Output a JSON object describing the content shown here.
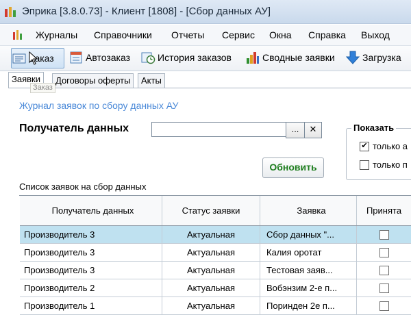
{
  "window": {
    "title": "Эприка [3.8.0.73] - Клиент [1808] - [Сбор данных АУ]"
  },
  "menu": [
    "Журналы",
    "Справочники",
    "Отчеты",
    "Сервис",
    "Окна",
    "Справка",
    "Выход"
  ],
  "toolbar": {
    "order": "Заказ",
    "auto_order": "Автозаказ",
    "order_history": "История заказов",
    "summary_requests": "Сводные заявки",
    "load": "Загрузка"
  },
  "tabs": [
    "Заявки",
    "Договоры оферты",
    "Акты"
  ],
  "tooltip": "Заказ",
  "form": {
    "journal_title": "Журнал заявок по сбору данных АУ",
    "recipient_label": "Получатель данных",
    "recipient_value": "",
    "browse_label": "...",
    "clear_label": "✕",
    "refresh_label": "Обновить"
  },
  "show": {
    "legend": "Показать",
    "options": [
      {
        "label": "только а",
        "checked": true
      },
      {
        "label": "только п",
        "checked": false
      }
    ]
  },
  "list": {
    "label": "Список заявок на сбор данных",
    "columns": [
      "Получатель данных",
      "Статус заявки",
      "Заявка",
      "Принята"
    ],
    "rows": [
      {
        "recipient": "Производитель 3",
        "status": "Актуальная",
        "request": "Сбор данных \"...",
        "accepted": false
      },
      {
        "recipient": "Производитель 3",
        "status": "Актуальная",
        "request": "Калия оротат",
        "accepted": false
      },
      {
        "recipient": "Производитель 3",
        "status": "Актуальная",
        "request": "Тестовая заяв...",
        "accepted": false
      },
      {
        "recipient": "Производитель 2",
        "status": "Актуальная",
        "request": "Вобэнзим 2-е п...",
        "accepted": false
      },
      {
        "recipient": "Производитель 1",
        "status": "Актуальная",
        "request": "Поринден 2е п...",
        "accepted": false
      }
    ]
  },
  "colors": {
    "selected_row": "#bfe1f0",
    "link_blue": "#4a89d8",
    "refresh_green": "#1e7d1e"
  },
  "icons": [
    "app-icon",
    "menu-app-icon",
    "order-icon",
    "auto-order-icon",
    "history-icon",
    "bar-chart-icon",
    "download-arrow-icon",
    "cursor-icon"
  ]
}
